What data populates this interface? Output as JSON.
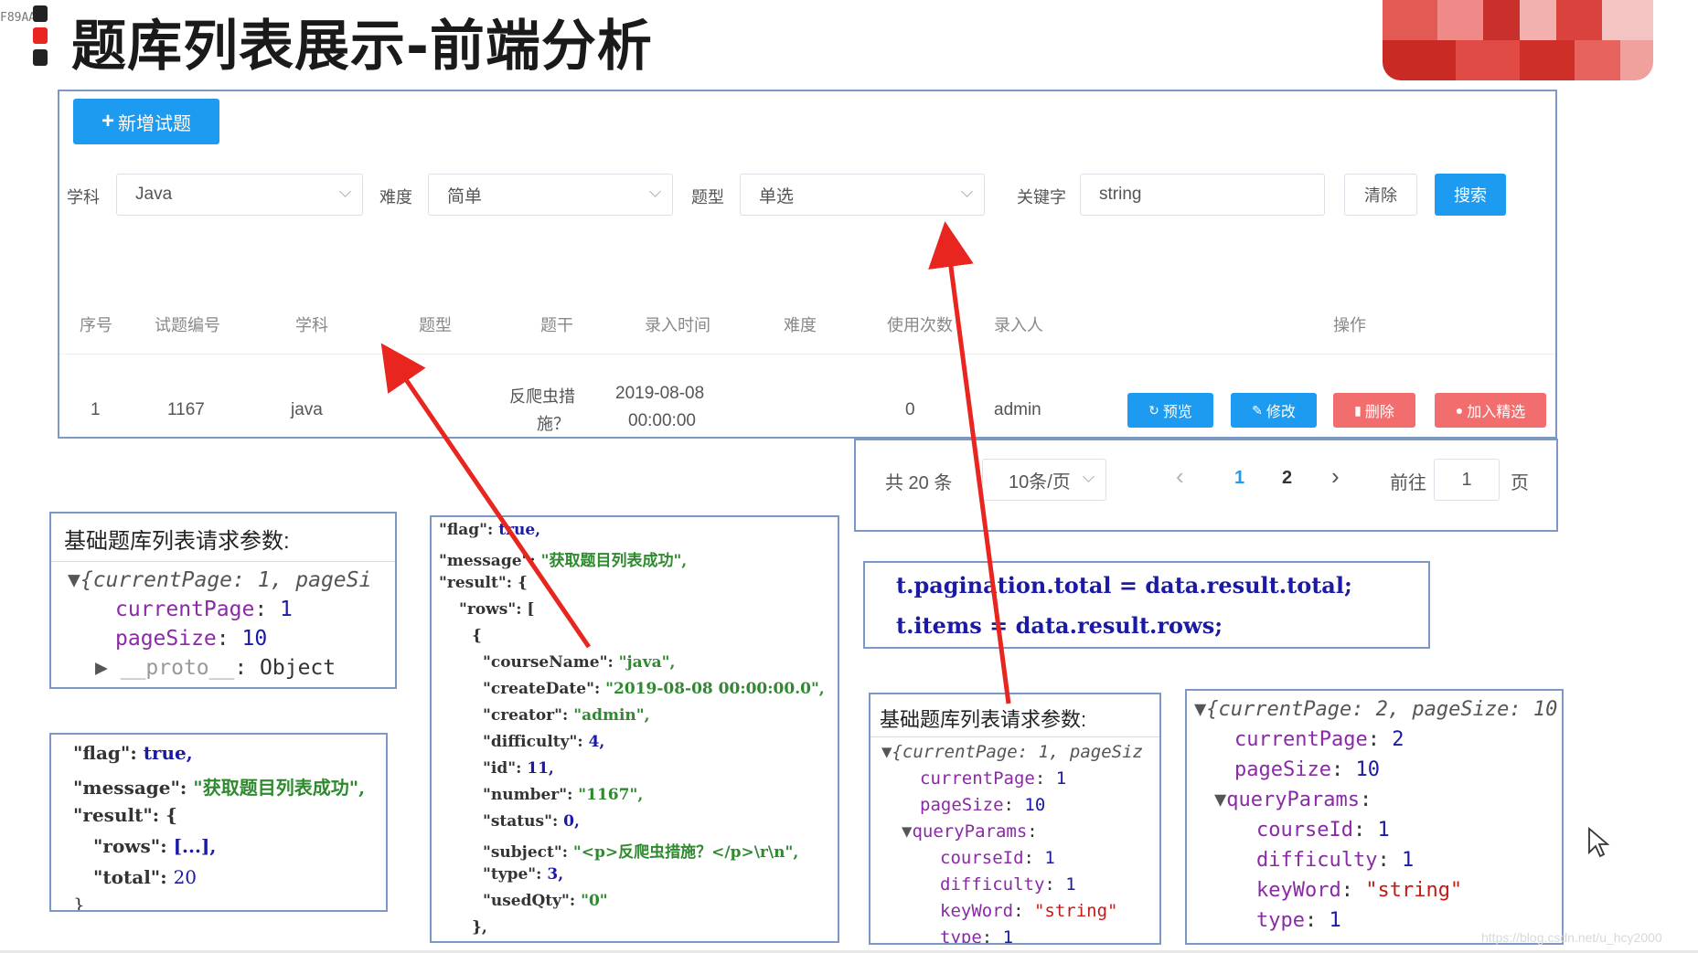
{
  "header": {
    "corner_code": "F89AA",
    "title": "题库列表展示-前端分析",
    "bar_colors": [
      "#222222",
      "#e8251f",
      "#222222"
    ]
  },
  "toolbar": {
    "add_label": "新增试题",
    "add_icon": "plus-icon"
  },
  "filters": {
    "subject_label": "学科",
    "subject_value": "Java",
    "difficulty_label": "难度",
    "difficulty_value": "简单",
    "type_label": "题型",
    "type_value": "单选",
    "keyword_label": "关键字",
    "keyword_value": "string",
    "clear_label": "清除",
    "search_label": "搜索"
  },
  "table": {
    "headers": [
      "序号",
      "试题编号",
      "学科",
      "题型",
      "题干",
      "录入时间",
      "难度",
      "使用次数",
      "录入人",
      "操作"
    ],
    "rows": [
      {
        "index": "1",
        "number": "1167",
        "subject": "java",
        "type": "",
        "stem_line1": "反爬虫措",
        "stem_line2": "施？",
        "time_line1": "2019-08-08",
        "time_line2": "00:00:00",
        "difficulty": "",
        "used": "0",
        "creator": "admin"
      }
    ],
    "actions": {
      "preview": "预览",
      "edit": "修改",
      "delete": "删除",
      "select": "加入精选"
    }
  },
  "pagination": {
    "total_text": "共 20 条",
    "page_size": "10条/页",
    "prev": "‹",
    "next": "›",
    "page1": "1",
    "page2": "2",
    "goto_label": "前往",
    "goto_value": "1",
    "page_suffix": "页"
  },
  "colors": {
    "primary": "#1d9bf0",
    "danger": "#f26e6e",
    "border_blue": "#7c99c6",
    "arrow_red": "#e8251f"
  },
  "box_request1": {
    "title": "基础题库列表请求参数:",
    "line1": "{currentPage: 1, pageSi",
    "l2_key": "currentPage",
    "l2_val": "1",
    "l3_key": "pageSize",
    "l3_val": "10",
    "l4_key": "__proto__",
    "l4_val": "Object"
  },
  "box_response1": {
    "l1_key": "\"flag\"",
    "l1_val": "true,",
    "l2_key": "\"message\"",
    "l2_val": "\"获取题目列表成功\",",
    "l3_key": "\"result\"",
    "l3_val": "{",
    "l4_key": "\"rows\"",
    "l4_val": "[...],",
    "l5_key": "\"total\"",
    "l5_val": "20",
    "l6": "}"
  },
  "box_response2": {
    "lines": [
      {
        "k": "\"flag\"",
        "v": "true,"
      },
      {
        "k": "\"message\"",
        "v": "\"获取题目列表成功\","
      },
      {
        "k": "\"result\"",
        "v": "{"
      },
      {
        "k": "\"rows\"",
        "v": "["
      },
      {
        "k": "",
        "v": "{"
      },
      {
        "k": "\"courseName\"",
        "v": "\"java\","
      },
      {
        "k": "\"createDate\"",
        "v": "\"2019-08-08 00:00:00.0\","
      },
      {
        "k": "\"creator\"",
        "v": "\"admin\","
      },
      {
        "k": "\"difficulty\"",
        "v": "4,"
      },
      {
        "k": "\"id\"",
        "v": "11,"
      },
      {
        "k": "\"number\"",
        "v": "\"1167\","
      },
      {
        "k": "\"status\"",
        "v": "0,"
      },
      {
        "k": "\"subject\"",
        "v": "\"<p>反爬虫措施？</p>\\r\\n\","
      },
      {
        "k": "\"type\"",
        "v": "3,"
      },
      {
        "k": "\"usedQty\"",
        "v": "\"0\""
      },
      {
        "k": "",
        "v": "},"
      }
    ]
  },
  "box_assign": {
    "line1": "t.pagination.total = data.result.total;",
    "line2": "t.items = data.result.rows;"
  },
  "box_request2": {
    "title": "基础题库列表请求参数:",
    "line1": "{currentPage: 1, pageSiz",
    "l2_key": "currentPage",
    "l2_val": "1",
    "l3_key": "pageSize",
    "l3_val": "10",
    "l4_key": "queryParams",
    "l5_key": "courseId",
    "l5_val": "1",
    "l6_key": "difficulty",
    "l6_val": "1",
    "l7_key": "keyWord",
    "l7_val": "\"string\"",
    "l8_key": "type",
    "l8_val": "1"
  },
  "box_request3": {
    "line1": "{currentPage: 2, pageSize: 10",
    "l2_key": "currentPage",
    "l2_val": "2",
    "l3_key": "pageSize",
    "l3_val": "10",
    "l4_key": "queryParams",
    "l5_key": "courseId",
    "l5_val": "1",
    "l6_key": "difficulty",
    "l6_val": "1",
    "l7_key": "keyWord",
    "l7_val": "\"string\"",
    "l8_key": "type",
    "l8_val": "1"
  },
  "watermark": "https://blog.csdn.net/u_hcy2000"
}
